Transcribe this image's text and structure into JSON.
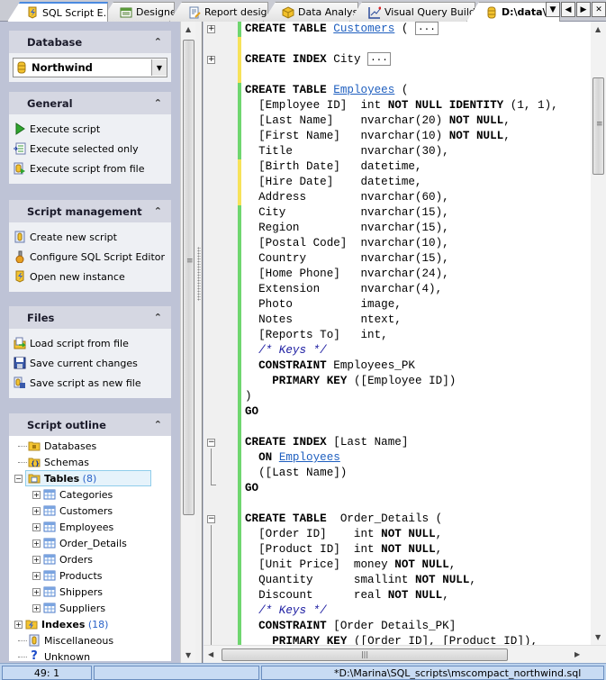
{
  "tabs": [
    {
      "label": "SQL Script E...",
      "icon": "script-editor-icon",
      "active": true
    },
    {
      "label": "Designer",
      "icon": "designer-icon"
    },
    {
      "label": "Report designer",
      "icon": "report-designer-icon"
    },
    {
      "label": "Data Analysis",
      "icon": "data-analysis-icon"
    },
    {
      "label": "Visual Query Builder",
      "icon": "query-builder-icon"
    },
    {
      "label": "D:\\data\\N",
      "icon": "database-icon",
      "bold": true
    }
  ],
  "tab_nav": {
    "dropdown": "▼",
    "prev": "◀",
    "next": "▶",
    "close": "✕"
  },
  "sidebar": {
    "database": {
      "title": "Database",
      "selected": "Northwind"
    },
    "general": {
      "title": "General",
      "items": [
        "Execute script",
        "Execute selected only",
        "Execute script from file"
      ]
    },
    "script_management": {
      "title": "Script management",
      "items": [
        "Create new script",
        "Configure SQL Script Editor",
        "Open new instance"
      ]
    },
    "files": {
      "title": "Files",
      "items": [
        "Load script from file",
        "Save current changes",
        "Save script as new file"
      ]
    },
    "outline": {
      "title": "Script outline",
      "databases": "Databases",
      "schemas": "Schemas",
      "tables_label": "Tables",
      "tables_count": "(8)",
      "tables": [
        "Categories",
        "Customers",
        "Employees",
        "Order_Details",
        "Orders",
        "Products",
        "Shippers",
        "Suppliers"
      ],
      "indexes_label": "Indexes",
      "indexes_count": "(18)",
      "miscellaneous": "Miscellaneous",
      "unknown": "Unknown"
    },
    "collapse_glyph": "≈"
  },
  "editor": {
    "lines": [
      "CREATE TABLE |Customers| ( [...]",
      "",
      "CREATE INDEX City [...]",
      "",
      "CREATE TABLE |Employees| (",
      "  [Employee ID]  int NOT NULL IDENTITY (1, 1),",
      "  [Last Name]    nvarchar(20) NOT NULL,",
      "  [First Name]   nvarchar(10) NOT NULL,",
      "  Title          nvarchar(30),",
      "  [Birth Date]   datetime,",
      "  [Hire Date]    datetime,",
      "  Address        nvarchar(60),",
      "  City           nvarchar(15),",
      "  Region         nvarchar(15),",
      "  [Postal Code]  nvarchar(10),",
      "  Country        nvarchar(15),",
      "  [Home Phone]   nvarchar(24),",
      "  Extension      nvarchar(4),",
      "  Photo          image,",
      "  Notes          ntext,",
      "  [Reports To]   int,",
      "  /* Keys */",
      "  CONSTRAINT Employees_PK",
      "    PRIMARY KEY ([Employee ID])",
      ")",
      "GO",
      "",
      "CREATE INDEX [Last Name]",
      "  ON |Employees|",
      "  ([Last Name])",
      "GO",
      "",
      "CREATE TABLE  Order_Details (",
      "  [Order ID]    int NOT NULL,",
      "  [Product ID]  int NOT NULL,",
      "  [Unit Price]  money NOT NULL,",
      "  Quantity      smallint NOT NULL,",
      "  Discount      real NOT NULL,",
      "  /* Keys */",
      "  CONSTRAINT [Order Details_PK]",
      "    PRIMARY KEY ([Order ID], [Product ID]),"
    ],
    "colors": {
      "keyword": "#000000",
      "link": "#1f5fbf",
      "comment": "#1a1aa0",
      "saved_change": "#6fd66f",
      "unsaved_change": "#f7e25a"
    }
  },
  "statusbar": {
    "position": "49:   1",
    "middle": "",
    "file": "*D:\\Marina\\SQL_scripts\\mscompact_northwind.sql"
  }
}
